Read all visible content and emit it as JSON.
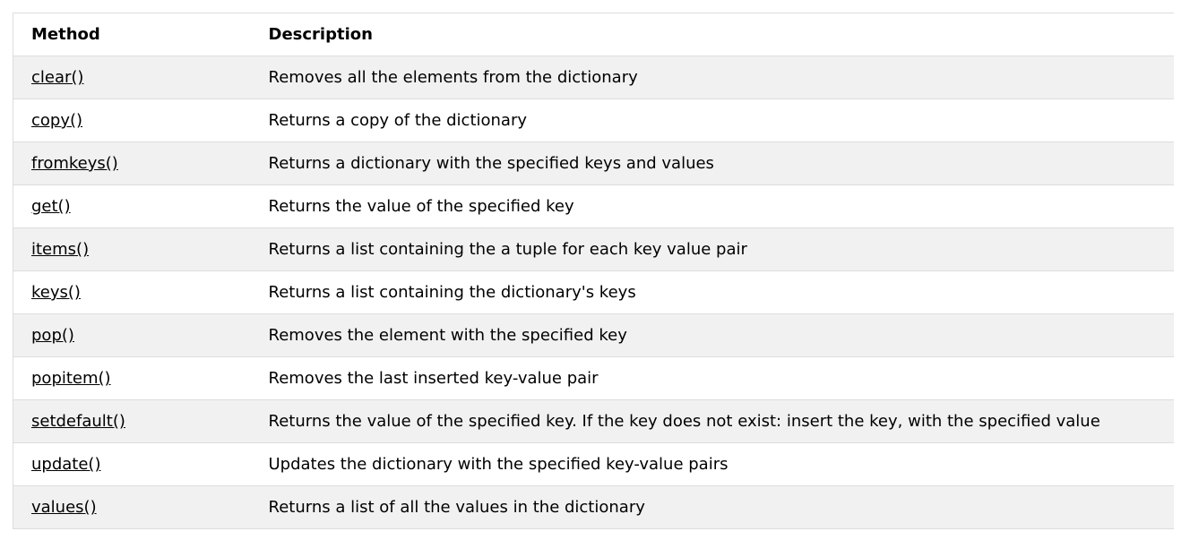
{
  "table": {
    "headers": {
      "method": "Method",
      "description": "Description"
    },
    "rows": [
      {
        "method": "clear()",
        "description": "Removes all the elements from the dictionary"
      },
      {
        "method": "copy()",
        "description": "Returns a copy of the dictionary"
      },
      {
        "method": "fromkeys()",
        "description": "Returns a dictionary with the specified keys and values"
      },
      {
        "method": "get()",
        "description": "Returns the value of the specified key"
      },
      {
        "method": "items()",
        "description": "Returns a list containing the a tuple for each key value pair"
      },
      {
        "method": "keys()",
        "description": "Returns a list containing the dictionary's keys"
      },
      {
        "method": "pop()",
        "description": "Removes the element with the specified key"
      },
      {
        "method": "popitem()",
        "description": "Removes the last inserted key-value pair"
      },
      {
        "method": "setdefault()",
        "description": "Returns the value of the specified key. If the key does not exist: insert the key, with the specified value"
      },
      {
        "method": "update()",
        "description": "Updates the dictionary with the specified key-value pairs"
      },
      {
        "method": "values()",
        "description": "Returns a list of all the values in the dictionary"
      }
    ]
  },
  "colors": {
    "row_stripe": "#f1f1f1",
    "border": "#dddddd",
    "text": "#000000"
  }
}
